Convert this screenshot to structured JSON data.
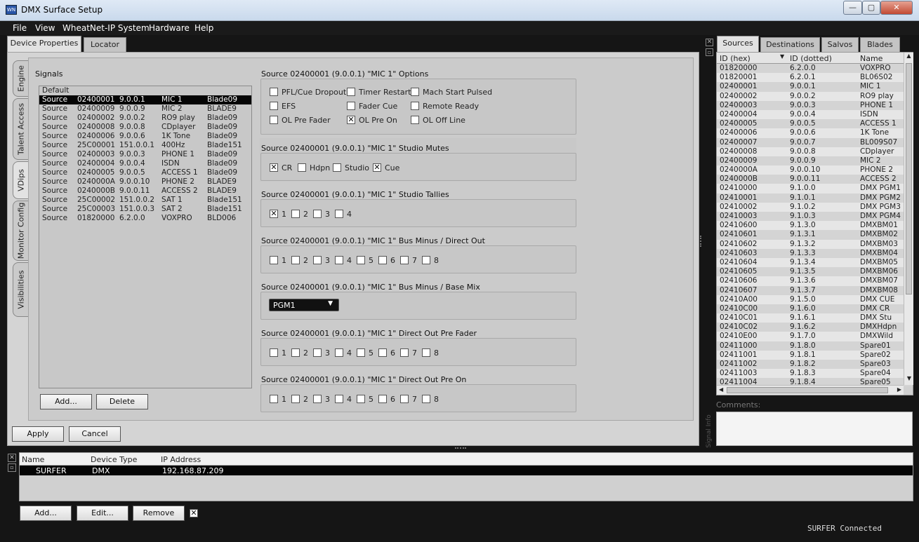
{
  "window": {
    "title": "DMX Surface Setup",
    "min": "—",
    "max": "▢",
    "close": "✕"
  },
  "menu": [
    "File",
    "View",
    "WheatNet-IP System",
    "Hardware",
    "Help"
  ],
  "top_tabs": [
    "Device Properties",
    "Locator"
  ],
  "side_tabs": [
    "Engine",
    "Talent Access",
    "VDips",
    "Monitor Config",
    "Visibilities"
  ],
  "signals": {
    "title": "Signals",
    "default_label": "Default",
    "rows": [
      [
        "Source",
        "02400001",
        "9.0.0.1",
        "MIC 1",
        "Blade09"
      ],
      [
        "Source",
        "02400009",
        "9.0.0.9",
        "MIC 2",
        "BLADE9"
      ],
      [
        "Source",
        "02400002",
        "9.0.0.2",
        "RO9 play",
        "Blade09"
      ],
      [
        "Source",
        "02400008",
        "9.0.0.8",
        "CDplayer",
        "Blade09"
      ],
      [
        "Source",
        "02400006",
        "9.0.0.6",
        "1K Tone",
        "Blade09"
      ],
      [
        "Source",
        "25C00001",
        "151.0.0.1",
        "400Hz",
        "Blade151"
      ],
      [
        "Source",
        "02400003",
        "9.0.0.3",
        "PHONE 1",
        "Blade09"
      ],
      [
        "Source",
        "02400004",
        "9.0.0.4",
        "ISDN",
        "Blade09"
      ],
      [
        "Source",
        "02400005",
        "9.0.0.5",
        "ACCESS 1",
        "Blade09"
      ],
      [
        "Source",
        "0240000A",
        "9.0.0.10",
        "PHONE 2",
        "BLADE9"
      ],
      [
        "Source",
        "0240000B",
        "9.0.0.11",
        "ACCESS 2",
        "BLADE9"
      ],
      [
        "Source",
        "25C00002",
        "151.0.0.2",
        "SAT 1",
        "Blade151"
      ],
      [
        "Source",
        "25C00003",
        "151.0.0.3",
        "SAT 2",
        "Blade151"
      ],
      [
        "Source",
        "01820000",
        "6.2.0.0",
        "VOXPRO",
        "BLD006"
      ]
    ],
    "add_label": "Add...",
    "delete_label": "Delete"
  },
  "options": {
    "title": "Source 02400001 (9.0.0.1) \"MIC 1\" Options",
    "items": [
      {
        "label": "PFL/Cue Dropout",
        "checked": false
      },
      {
        "label": "Timer Restart",
        "checked": false
      },
      {
        "label": "Mach Start Pulsed",
        "checked": false
      },
      {
        "label": "EFS",
        "checked": false
      },
      {
        "label": "Fader Cue",
        "checked": false
      },
      {
        "label": "Remote Ready",
        "checked": false
      },
      {
        "label": "OL Pre Fader",
        "checked": false
      },
      {
        "label": "OL Pre On",
        "checked": true
      },
      {
        "label": "OL Off Line",
        "checked": false
      }
    ]
  },
  "mutes": {
    "title": "Source 02400001 (9.0.0.1) \"MIC 1\" Studio Mutes",
    "items": [
      {
        "label": "CR",
        "checked": true
      },
      {
        "label": "Hdpn",
        "checked": false
      },
      {
        "label": "Studio",
        "checked": false
      },
      {
        "label": "Cue",
        "checked": true
      }
    ]
  },
  "tallies": {
    "title": "Source 02400001 (9.0.0.1) \"MIC 1\" Studio Tallies",
    "items": [
      {
        "label": "1",
        "checked": true
      },
      {
        "label": "2",
        "checked": false
      },
      {
        "label": "3",
        "checked": false
      },
      {
        "label": "4",
        "checked": false
      }
    ]
  },
  "busminus": {
    "title": "Source 02400001 (9.0.0.1) \"MIC 1\" Bus Minus / Direct Out",
    "items": [
      "1",
      "2",
      "3",
      "4",
      "5",
      "6",
      "7",
      "8"
    ]
  },
  "basemix": {
    "title": "Source 02400001 (9.0.0.1) \"MIC 1\" Bus Minus / Base Mix",
    "selected": "PGM1"
  },
  "dopre": {
    "title": "Source 02400001 (9.0.0.1) \"MIC 1\" Direct Out Pre Fader",
    "items": [
      "1",
      "2",
      "3",
      "4",
      "5",
      "6",
      "7",
      "8"
    ]
  },
  "doon": {
    "title": "Source 02400001 (9.0.0.1) \"MIC 1\" Direct Out Pre On",
    "items": [
      "1",
      "2",
      "3",
      "4",
      "5",
      "6",
      "7",
      "8"
    ]
  },
  "apply_label": "Apply",
  "cancel_label": "Cancel",
  "right_tabs": [
    "Sources",
    "Destinations",
    "Salvos",
    "Blades"
  ],
  "sources": {
    "headers": [
      "ID (hex)",
      "ID (dotted)",
      "Name"
    ],
    "rows": [
      [
        "01820000",
        "6.2.0.0",
        "VOXPRO"
      ],
      [
        "01820001",
        "6.2.0.1",
        "BL06S02"
      ],
      [
        "02400001",
        "9.0.0.1",
        "MIC 1"
      ],
      [
        "02400002",
        "9.0.0.2",
        "RO9 play"
      ],
      [
        "02400003",
        "9.0.0.3",
        "PHONE 1"
      ],
      [
        "02400004",
        "9.0.0.4",
        "ISDN"
      ],
      [
        "02400005",
        "9.0.0.5",
        "ACCESS 1"
      ],
      [
        "02400006",
        "9.0.0.6",
        "1K Tone"
      ],
      [
        "02400007",
        "9.0.0.7",
        "BL009S07"
      ],
      [
        "02400008",
        "9.0.0.8",
        "CDplayer"
      ],
      [
        "02400009",
        "9.0.0.9",
        "MIC 2"
      ],
      [
        "0240000A",
        "9.0.0.10",
        "PHONE 2"
      ],
      [
        "0240000B",
        "9.0.0.11",
        "ACCESS 2"
      ],
      [
        "02410000",
        "9.1.0.0",
        "DMX PGM1"
      ],
      [
        "02410001",
        "9.1.0.1",
        "DMX PGM2"
      ],
      [
        "02410002",
        "9.1.0.2",
        "DMX PGM3"
      ],
      [
        "02410003",
        "9.1.0.3",
        "DMX PGM4"
      ],
      [
        "02410600",
        "9.1.3.0",
        "DMXBM01"
      ],
      [
        "02410601",
        "9.1.3.1",
        "DMXBM02"
      ],
      [
        "02410602",
        "9.1.3.2",
        "DMXBM03"
      ],
      [
        "02410603",
        "9.1.3.3",
        "DMXBM04"
      ],
      [
        "02410604",
        "9.1.3.4",
        "DMXBM05"
      ],
      [
        "02410605",
        "9.1.3.5",
        "DMXBM06"
      ],
      [
        "02410606",
        "9.1.3.6",
        "DMXBM07"
      ],
      [
        "02410607",
        "9.1.3.7",
        "DMXBM08"
      ],
      [
        "02410A00",
        "9.1.5.0",
        "DMX CUE"
      ],
      [
        "02410C00",
        "9.1.6.0",
        "DMX CR"
      ],
      [
        "02410C01",
        "9.1.6.1",
        "DMX Stu"
      ],
      [
        "02410C02",
        "9.1.6.2",
        "DMXHdpn"
      ],
      [
        "02410E00",
        "9.1.7.0",
        "DMXWild"
      ],
      [
        "02411000",
        "9.1.8.0",
        "Spare01"
      ],
      [
        "02411001",
        "9.1.8.1",
        "Spare02"
      ],
      [
        "02411002",
        "9.1.8.2",
        "Spare03"
      ],
      [
        "02411003",
        "9.1.8.3",
        "Spare04"
      ],
      [
        "02411004",
        "9.1.8.4",
        "Spare05"
      ]
    ]
  },
  "comments_label": "Comments:",
  "side_label": "Signal Info",
  "devices": {
    "headers": [
      "Name",
      "Device Type",
      "IP Address"
    ],
    "rows": [
      [
        "SURFER",
        "DMX",
        "192.168.87.209"
      ]
    ],
    "add_label": "Add...",
    "edit_label": "Edit...",
    "remove_label": "Remove"
  },
  "status": "SURFER Connected"
}
